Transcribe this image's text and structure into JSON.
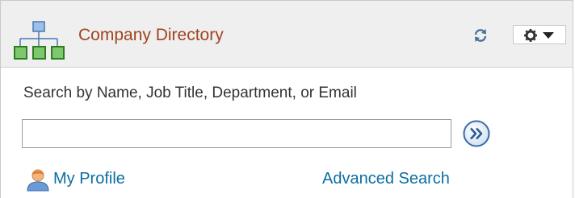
{
  "pagelet": {
    "title": "Company Directory",
    "title_icon": "org-chart-icon",
    "refresh_icon": "refresh-icon",
    "actions_icon": "gear-icon",
    "actions_caret_icon": "caret-down-icon"
  },
  "search": {
    "label": "Search by Name, Job Title, Department, or Email",
    "value": "",
    "placeholder": "",
    "go_icon": "double-chevron-right-icon"
  },
  "links": {
    "my_profile": "My Profile",
    "my_profile_icon": "person-icon",
    "advanced_search": "Advanced Search"
  },
  "colors": {
    "title": "#a0441f",
    "link": "#0b6ea3",
    "org_chart_green": "#3d9a2c",
    "org_chart_blue": "#7aa6d6",
    "header_bg": "#efefef"
  }
}
